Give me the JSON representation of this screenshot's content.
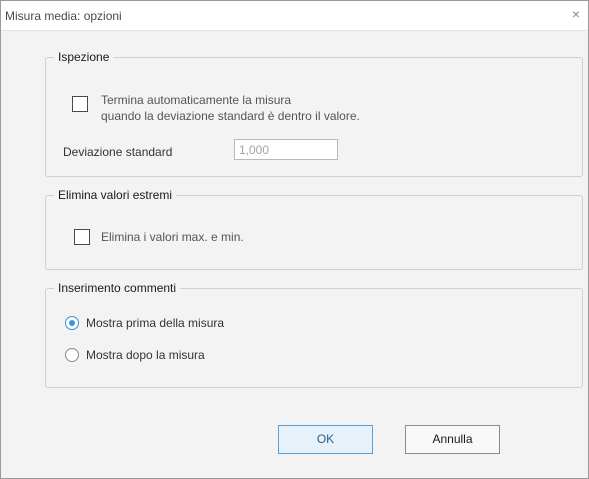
{
  "window": {
    "title": "Misura media: opzioni",
    "close_glyph": "×"
  },
  "inspection": {
    "legend": "Ispezione",
    "auto_stop_line1": "Termina automaticamente la misura",
    "auto_stop_line2": "quando la deviazione standard è dentro il valore.",
    "auto_stop_checked": false,
    "std_dev_label": "Deviazione standard",
    "std_dev_value": "1,000"
  },
  "extremes": {
    "legend": "Elimina valori estremi",
    "remove_label": "Elimina i valori max. e min.",
    "remove_checked": false
  },
  "comments": {
    "legend": "Inserimento commenti",
    "options": [
      {
        "label": "Mostra prima della misura",
        "selected": true
      },
      {
        "label": "Mostra dopo la misura",
        "selected": false
      }
    ]
  },
  "buttons": {
    "ok_label": "OK",
    "cancel_label": "Annulla"
  },
  "colors": {
    "accent": "#3b96de",
    "dialog_bg": "#f3f3f3"
  }
}
